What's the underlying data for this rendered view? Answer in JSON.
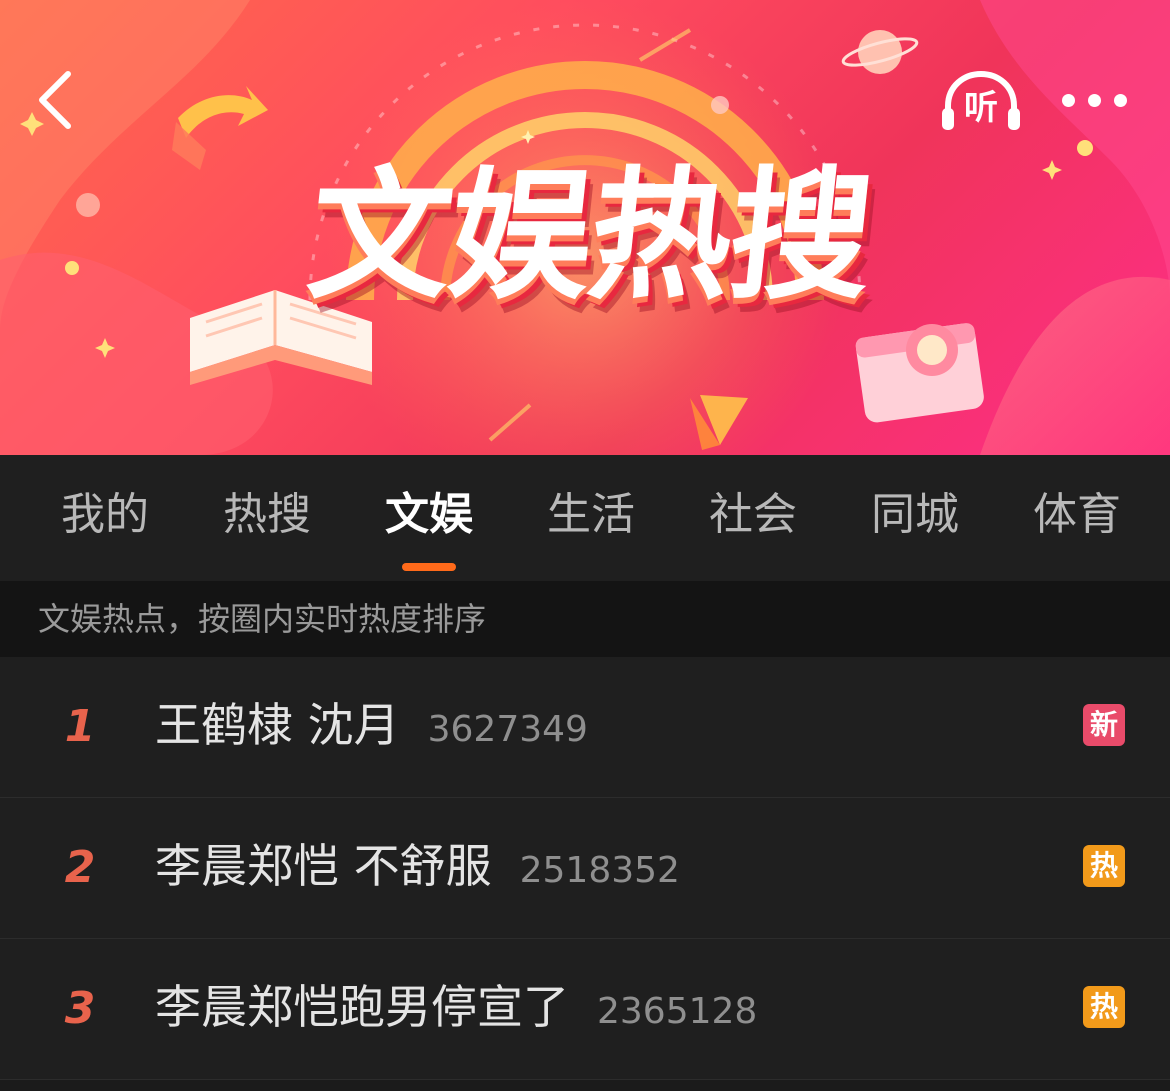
{
  "banner": {
    "title": "文娱热搜",
    "listen_label": "听"
  },
  "tabs": [
    {
      "label": "我的",
      "active": false
    },
    {
      "label": "热搜",
      "active": false
    },
    {
      "label": "文娱",
      "active": true
    },
    {
      "label": "生活",
      "active": false
    },
    {
      "label": "社会",
      "active": false
    },
    {
      "label": "同城",
      "active": false
    },
    {
      "label": "体育",
      "active": false
    }
  ],
  "subtitle": "文娱热点，按圈内实时热度排序",
  "list": [
    {
      "rank": "1",
      "topic": "王鹤棣 沈月",
      "count": "3627349",
      "badge": "新",
      "badge_color": "#e94b6a"
    },
    {
      "rank": "2",
      "topic": "李晨郑恺 不舒服",
      "count": "2518352",
      "badge": "热",
      "badge_color": "#f29a1a"
    },
    {
      "rank": "3",
      "topic": "李晨郑恺跑男停宣了",
      "count": "2365128",
      "badge": "热",
      "badge_color": "#f29a1a"
    }
  ],
  "colors": {
    "accent": "#ff6a1a",
    "rank": "#e8634c"
  },
  "icons": {
    "back": "chevron-left-icon",
    "listen": "headphones-icon",
    "more": "more-dots-icon"
  }
}
